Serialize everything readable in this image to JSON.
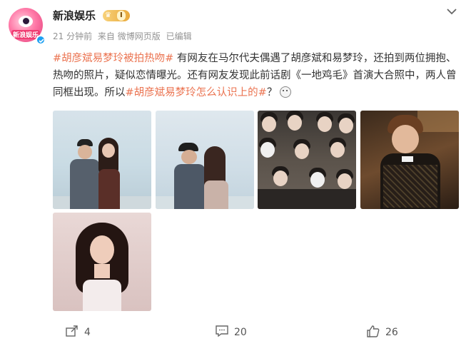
{
  "post": {
    "username": "新浪娱乐",
    "vip_level": "Ⅰ",
    "time": "21 分钟前",
    "source": "来自 微博网页版",
    "edited": "已编辑",
    "avatar_text": "新浪娱乐",
    "text": {
      "hashtag1": "#胡彦斌易梦玲被拍热吻#",
      "body1": " 有网友在马尔代夫偶遇了胡彦斌和易梦玲，还拍到两位拥抱、热吻的照片，疑似恋情曝光。还有网友发现此前话剧《一地鸡毛》首演大合照中，两人曾同框出现。所以",
      "hashtag2": "#胡彦斌易梦玲怎么认识上的#",
      "body2": "？"
    },
    "images": [
      {
        "name": "photo-couple-hug"
      },
      {
        "name": "photo-couple-kiss"
      },
      {
        "name": "photo-group-audience"
      },
      {
        "name": "photo-man-suit"
      },
      {
        "name": "photo-woman-portrait"
      }
    ]
  },
  "actions": {
    "share_count": "4",
    "comment_count": "20",
    "like_count": "26"
  },
  "colors": {
    "hashtag": "#eb7350",
    "meta": "#939393",
    "verified": "#1ea0f2"
  },
  "icons": {
    "menu": "chevron-down-icon",
    "share": "share-icon",
    "comment": "comment-icon",
    "like": "thumbs-up-icon",
    "emoji": "doge-emoji-icon"
  }
}
